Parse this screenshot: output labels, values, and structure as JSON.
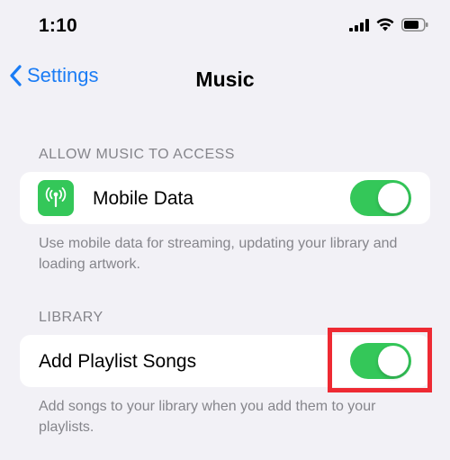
{
  "status_bar": {
    "time": "1:10",
    "icons": [
      "cellular-signal-icon",
      "wifi-icon",
      "battery-icon"
    ]
  },
  "nav": {
    "back_label": "Settings",
    "title": "Music"
  },
  "sections": {
    "access": {
      "header": "ALLOW MUSIC TO ACCESS",
      "row_label": "Mobile Data",
      "row_icon": "antenna-icon",
      "toggle_on": true,
      "footer": "Use mobile data for streaming, updating your library and loading artwork."
    },
    "library": {
      "header": "LIBRARY",
      "row_label": "Add Playlist Songs",
      "toggle_on": true,
      "footer": "Add songs to your library when you add them to your playlists."
    }
  },
  "colors": {
    "accent": "#1a7cf5",
    "toggle_on": "#34c759",
    "highlight": "#ee2a33",
    "background": "#f2f1f6"
  }
}
